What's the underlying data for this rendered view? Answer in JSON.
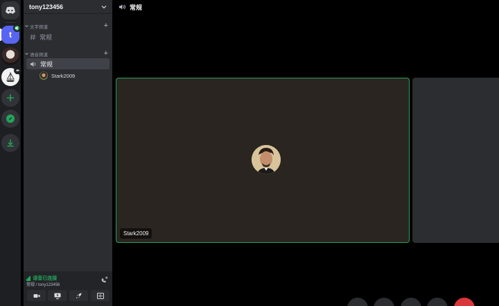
{
  "server_rail": {
    "servers": [
      {
        "name": "home",
        "icon": "discord-logo-icon"
      },
      {
        "name": "t",
        "label": "t"
      },
      {
        "name": "anime-server"
      },
      {
        "name": "ship-server"
      }
    ],
    "actions": [
      "add-server-icon",
      "explore-compass-icon",
      "download-icon"
    ]
  },
  "sidebar": {
    "server_name": "tony123456",
    "categories": {
      "text": "文字频道",
      "voice": "语音频道"
    },
    "text_channels": [
      {
        "name": "常规"
      }
    ],
    "voice_channels": [
      {
        "name": "常规"
      }
    ],
    "voice_users": [
      {
        "name": "Stark2009"
      }
    ]
  },
  "voice_panel": {
    "status": "语音已连接",
    "location": "常规 / tony123456"
  },
  "main": {
    "channel_title": "常规",
    "participant": {
      "name": "Stark2009"
    }
  },
  "colors": {
    "accent_green": "#23a55a",
    "brand": "#5865f2",
    "danger": "#da373c"
  }
}
